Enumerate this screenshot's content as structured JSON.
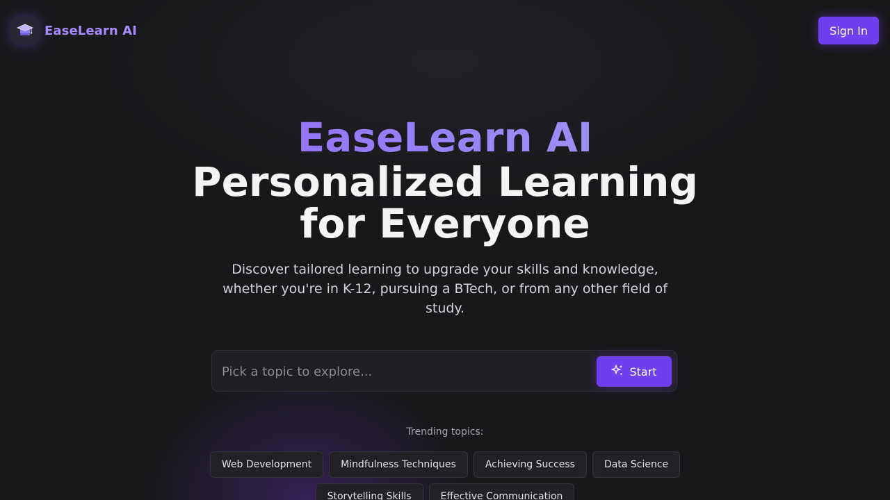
{
  "header": {
    "brand_name": "EaseLearn AI",
    "logo_icon": "graduation-cap-icon",
    "signin_label": "Sign In"
  },
  "hero": {
    "brand": "EaseLearn AI",
    "title": "Personalized Learning for Everyone",
    "subtitle": "Discover tailored learning to upgrade your skills and knowledge, whether you're in K-12, pursuing a BTech, or from any other field of study."
  },
  "search": {
    "placeholder": "Pick a topic to explore...",
    "value": "",
    "start_label": "Start",
    "start_icon": "sparkles-icon"
  },
  "trending": {
    "label": "Trending topics:",
    "topics": [
      "Web Development",
      "Mindfulness Techniques",
      "Achieving Success",
      "Data Science",
      "Storytelling Skills",
      "Effective Communication"
    ]
  },
  "colors": {
    "background": "#18181b",
    "accent": "#6d3ff0",
    "brand_text": "#a78bfa"
  }
}
